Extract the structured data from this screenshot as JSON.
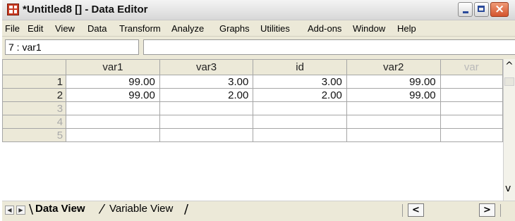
{
  "window": {
    "title": "*Untitled8 [] - Data Editor",
    "app_icon": "spss-grid-icon",
    "controls": {
      "minimize": "minimize-icon",
      "maximize": "maximize-icon",
      "close": "×"
    }
  },
  "menu": [
    "File",
    "Edit",
    "View",
    "Data",
    "Transform",
    "Analyze",
    "Graphs",
    "Utilities",
    "Add-ons",
    "Window",
    "Help"
  ],
  "cell_editor": {
    "reference": "7 : var1",
    "value": ""
  },
  "grid": {
    "columns": [
      "var1",
      "var3",
      "id",
      "var2",
      "var"
    ],
    "rows": [
      {
        "num": "1",
        "cells": [
          "99.00",
          "3.00",
          "3.00",
          "99.00",
          ""
        ]
      },
      {
        "num": "2",
        "cells": [
          "99.00",
          "2.00",
          "2.00",
          "99.00",
          ""
        ]
      },
      {
        "num": "3",
        "cells": [
          "",
          "",
          "",
          "",
          ""
        ]
      },
      {
        "num": "4",
        "cells": [
          "",
          "",
          "",
          "",
          ""
        ]
      },
      {
        "num": "5",
        "cells": [
          "",
          "",
          "",
          "",
          ""
        ]
      }
    ]
  },
  "tabs": {
    "data_view": "Data View",
    "variable_view": "Variable View"
  },
  "scroll": {
    "up": "^",
    "down": "v",
    "left": "<",
    "right": ">"
  },
  "colors": {
    "chrome": "#ece9d8",
    "close_button": "#d4542e",
    "grid_line": "#a6a6a6"
  }
}
